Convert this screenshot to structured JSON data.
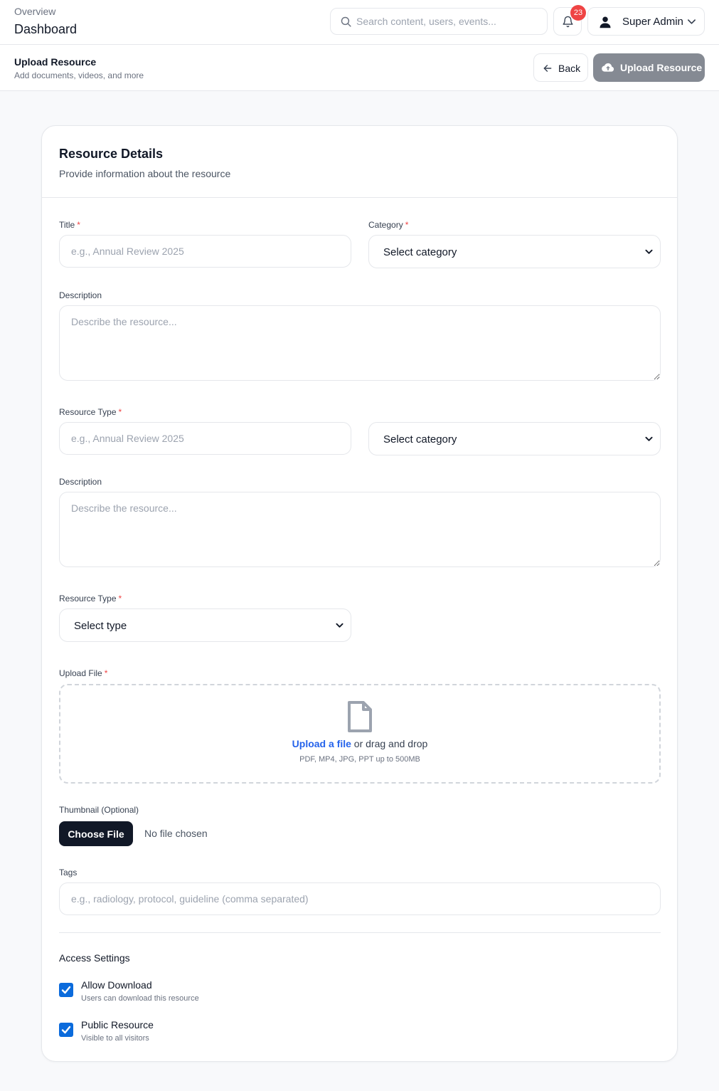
{
  "header": {
    "breadcrumb": "Overview",
    "title": "Dashboard",
    "search_placeholder": "Search content, users, events...",
    "notification_count": "23",
    "user_name": "Super Admin"
  },
  "subheader": {
    "title": "Upload Resource",
    "description": "Add documents, videos, and more",
    "back_label": "Back",
    "upload_label": "Upload Resource"
  },
  "form": {
    "title": "Resource Details",
    "subtitle": "Provide information about the resource",
    "required_mark": "*",
    "title_label": "Title",
    "title_placeholder": "e.g., Annual Review 2025",
    "category_label": "Category",
    "category_value": "Select category",
    "description_label": "Description",
    "description_placeholder": "Describe the resource...",
    "resource_type_label": "Resource Type",
    "resource_type_placeholder": "e.g., Annual Review 2025",
    "category_value_2": "Select category",
    "description_label_2": "Description",
    "description_placeholder_2": "Describe the resource...",
    "resource_type_label_2": "Resource Type",
    "type_value": "Select type",
    "upload_file_label": "Upload File",
    "upload_link": "Upload a file",
    "upload_text": " or drag and drop",
    "upload_hint": "PDF, MP4, JPG, PPT up to 500MB",
    "thumbnail_label": "Thumbnail (Optional)",
    "choose_file_label": "Choose File",
    "no_file_text": "No file chosen",
    "tags_label": "Tags",
    "tags_placeholder": "e.g., radiology, protocol, guideline (comma separated)"
  },
  "access": {
    "title": "Access Settings",
    "allow_download": {
      "label": "Allow Download",
      "description": "Users can download this resource",
      "checked": true
    },
    "public_resource": {
      "label": "Public Resource",
      "description": "Visible to all visitors",
      "checked": true
    }
  },
  "colors": {
    "accent": "#0b6bdc",
    "link": "#2563eb",
    "badge": "#ef4444",
    "upload_button": "#858a93",
    "dark_button": "#111827"
  },
  "icons": [
    "search-icon",
    "bell-icon",
    "user-icon",
    "chevron-down-icon",
    "arrow-left-icon",
    "cloud-upload-icon",
    "file-icon",
    "check-icon"
  ]
}
